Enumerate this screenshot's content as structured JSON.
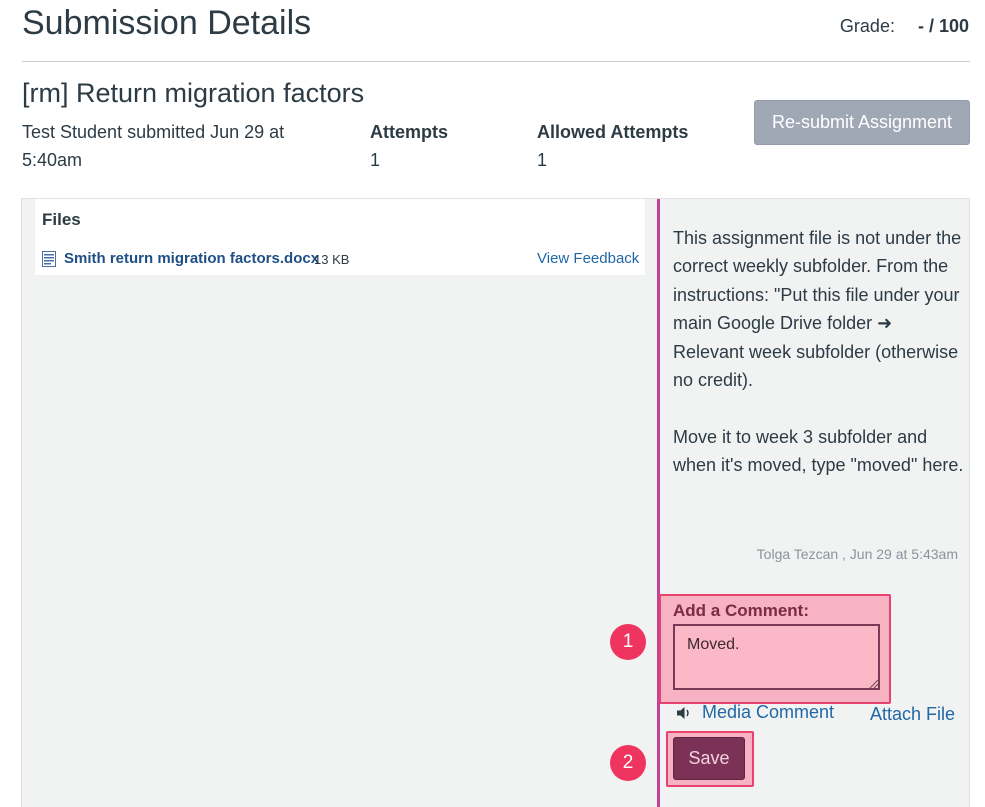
{
  "header": {
    "title": "Submission Details",
    "grade_label": "Grade:",
    "grade_value": "- / 100"
  },
  "assignment": {
    "title": "[rm] Return migration factors",
    "submitted_by": "Test Student submitted Jun 29 at 5:40am",
    "attempts_label": "Attempts",
    "attempts_value": "1",
    "allowed_label": "Allowed Attempts",
    "allowed_value": "1",
    "resubmit_label": "Re-submit Assignment"
  },
  "files": {
    "heading": "Files",
    "items": [
      {
        "name": "Smith return migration factors.docx",
        "size": "13 KB",
        "feedback_label": "View Feedback",
        "icon": "document-icon"
      }
    ]
  },
  "comments": {
    "items": [
      {
        "paragraphs": [
          "This assignment file is not under the correct weekly subfolder. From the instructions: \"Put this file under your main Google Drive folder ➜ Relevant week subfolder (otherwise no credit).",
          "Move it to week 3 subfolder and when it's moved, type \"moved\" here."
        ],
        "author_time": "Tolga Tezcan , Jun 29 at 5:43am"
      }
    ],
    "add_label": "Add a Comment:",
    "input_value": "Moved.",
    "media_label": "Media Comment",
    "attach_label": "Attach File",
    "save_label": "Save"
  },
  "annotations": {
    "badge_1": "1",
    "badge_2": "2",
    "highlight_color": "#e8426e",
    "badge_color": "#ef355f"
  },
  "colors": {
    "divider": "#c0439a",
    "link": "#2068a6",
    "save_button": "#7c3256",
    "resubmit_button": "#a0a8b6"
  }
}
